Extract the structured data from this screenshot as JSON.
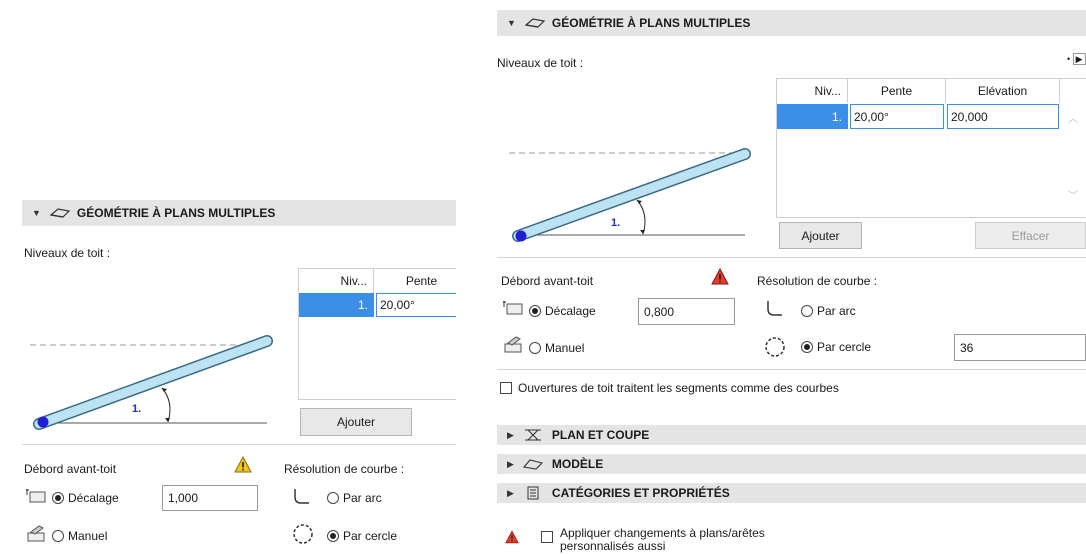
{
  "section_title": "GÉOMÉTRIE À PLANS MULTIPLES",
  "roof_levels_label": "Niveaux de toit :",
  "table": {
    "col_level": "Niv...",
    "col_slope": "Pente",
    "col_elevation": "Elévation",
    "rows": [
      {
        "level": "1.",
        "slope": "20,00°",
        "elevation": "20,000"
      }
    ]
  },
  "diagram_level_label": "1.",
  "buttons": {
    "add": "Ajouter",
    "delete": "Effacer"
  },
  "eaves": {
    "title": "Débord avant-toit",
    "offset_label": "Décalage",
    "manual_label": "Manuel",
    "offset_value_left": "1,000",
    "offset_value_right": "0,800"
  },
  "curve": {
    "title": "Résolution de courbe :",
    "by_arc": "Par arc",
    "by_circle": "Par cercle",
    "circle_value": "36"
  },
  "openings_checkbox": "Ouvertures de toit traitent les segments comme des courbes",
  "sections": [
    "PLAN ET COUPE",
    "MODÈLE",
    "CATÉGORIES ET PROPRIÉTÉS"
  ],
  "apply_checkbox": "Appliquer changements à plans/arêtes personnalisés aussi",
  "colors": {
    "header_bg": "#e4e4e4",
    "selection": "#3d8ee6",
    "warning": "#e53b2c",
    "warning_yellow": "#f3c623"
  }
}
